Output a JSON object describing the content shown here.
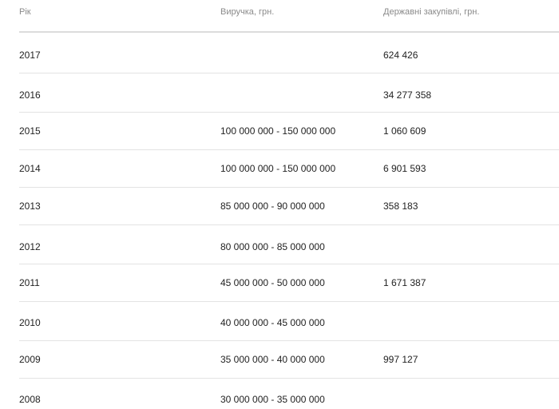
{
  "table": {
    "headers": {
      "year": "Рік",
      "revenue": "Виручка, грн.",
      "procurement": "Державні закупівлі, грн."
    },
    "rows": [
      {
        "year": "2017",
        "revenue": "",
        "procurement": "624 426"
      },
      {
        "year": "2016",
        "revenue": "",
        "procurement": "34 277 358"
      },
      {
        "year": "2015",
        "revenue": "100 000 000 - 150 000 000",
        "procurement": "1 060 609"
      },
      {
        "year": "2014",
        "revenue": "100 000 000 - 150 000 000",
        "procurement": "6 901 593"
      },
      {
        "year": "2013",
        "revenue": "85 000 000 - 90 000 000",
        "procurement": "358 183"
      },
      {
        "year": "2012",
        "revenue": "80 000 000 - 85 000 000",
        "procurement": ""
      },
      {
        "year": "2011",
        "revenue": "45 000 000 - 50 000 000",
        "procurement": "1 671 387"
      },
      {
        "year": "2010",
        "revenue": "40 000 000 - 45 000 000",
        "procurement": ""
      },
      {
        "year": "2009",
        "revenue": "35 000 000 - 40 000 000",
        "procurement": "997 127"
      },
      {
        "year": "2008",
        "revenue": "30 000 000 - 35 000 000",
        "procurement": ""
      }
    ]
  }
}
